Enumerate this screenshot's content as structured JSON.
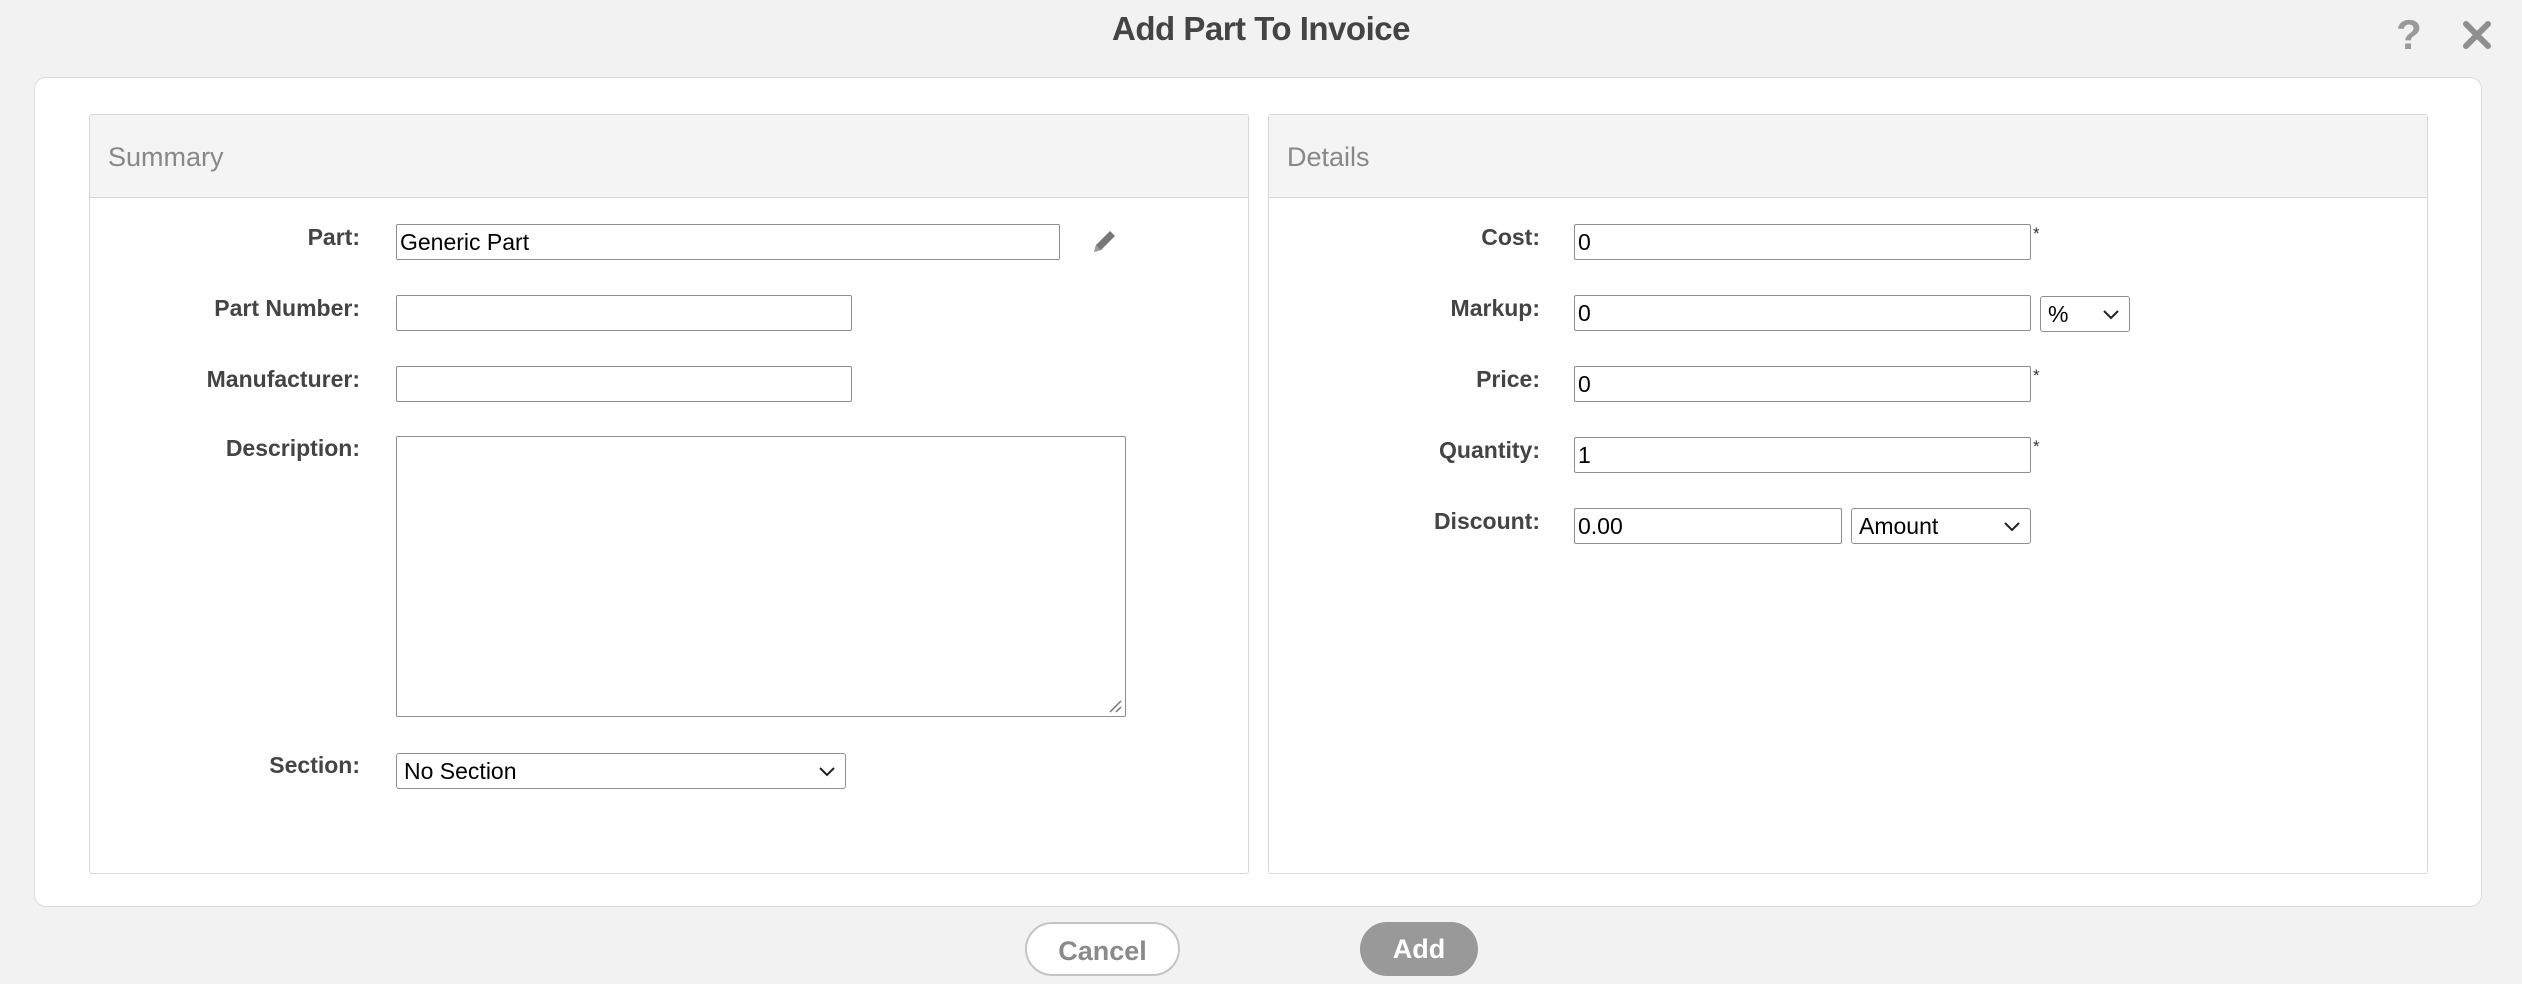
{
  "dialog": {
    "title": "Add Part To Invoice"
  },
  "icons": {
    "help": "question-mark-icon",
    "close": "close-icon",
    "edit": "pencil-icon",
    "chevron": "chevron-down-icon"
  },
  "summary": {
    "heading": "Summary",
    "part": {
      "label": "Part:",
      "value": "Generic Part"
    },
    "part_number": {
      "label": "Part Number:",
      "value": ""
    },
    "manufacturer": {
      "label": "Manufacturer:",
      "value": ""
    },
    "description": {
      "label": "Description:",
      "value": ""
    },
    "section": {
      "label": "Section:",
      "value": "No Section"
    }
  },
  "details": {
    "heading": "Details",
    "cost": {
      "label": "Cost:",
      "value": "0"
    },
    "markup": {
      "label": "Markup:",
      "value": "0",
      "unit": "%"
    },
    "price": {
      "label": "Price:",
      "value": "0"
    },
    "quantity": {
      "label": "Quantity:",
      "value": "1"
    },
    "discount": {
      "label": "Discount:",
      "value": "0.00",
      "type": "Amount"
    },
    "required_marker": "*"
  },
  "actions": {
    "cancel": "Cancel",
    "add": "Add"
  },
  "colors": {
    "add_button": "#999999",
    "background": "#f2f2f2",
    "panel_header": "#f4f4f4"
  }
}
